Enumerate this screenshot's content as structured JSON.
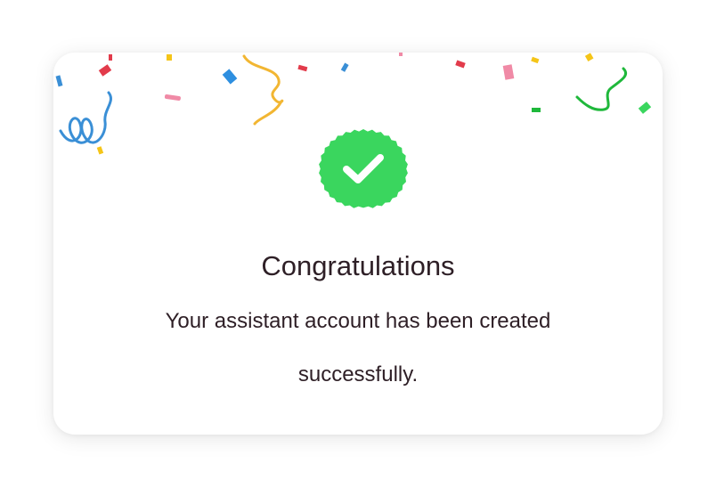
{
  "dialog": {
    "title": "Congratulations",
    "message": "Your assistant account has been created successfully.",
    "icon": "verified-check-badge-icon",
    "decoration": "confetti"
  },
  "colors": {
    "badge_green": "#3ad65e",
    "text": "#2e1f26",
    "card_background": "#ffffff"
  }
}
